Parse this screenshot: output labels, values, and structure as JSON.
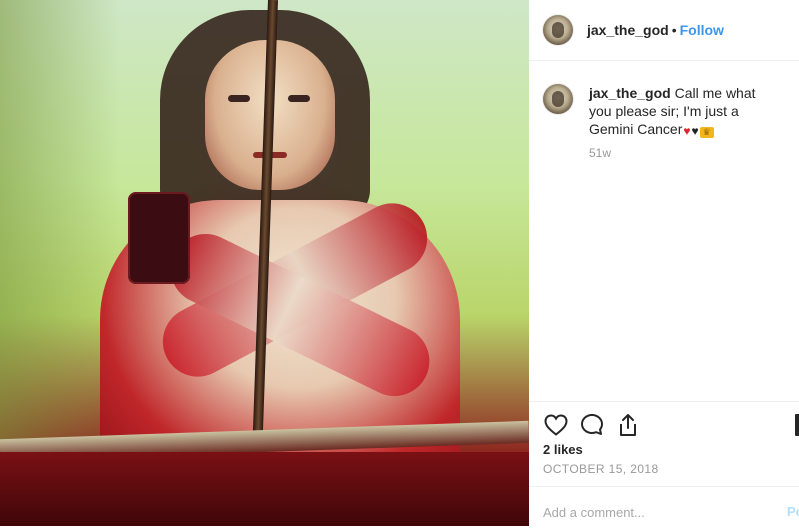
{
  "post": {
    "username": "jax_the_god",
    "follow_label": "Follow",
    "separator": "•",
    "caption_text": "Call me what you please sir; I'm just a Gemini Cancer",
    "caption_emojis": [
      "fire-emoji",
      "black-heart-emoji",
      "crown-emoji"
    ],
    "timestamp_short": "51w",
    "likes": "2 likes",
    "date": "OCTOBER 15, 2018",
    "comment_placeholder": "Add a comment...",
    "post_label": "Po"
  },
  "icons": [
    "heart-icon",
    "comment-icon",
    "share-icon"
  ],
  "colors": {
    "follow": "#3897f0",
    "secondary_text": "#999999",
    "border": "#efefef",
    "post_button": "#b2dffc"
  }
}
